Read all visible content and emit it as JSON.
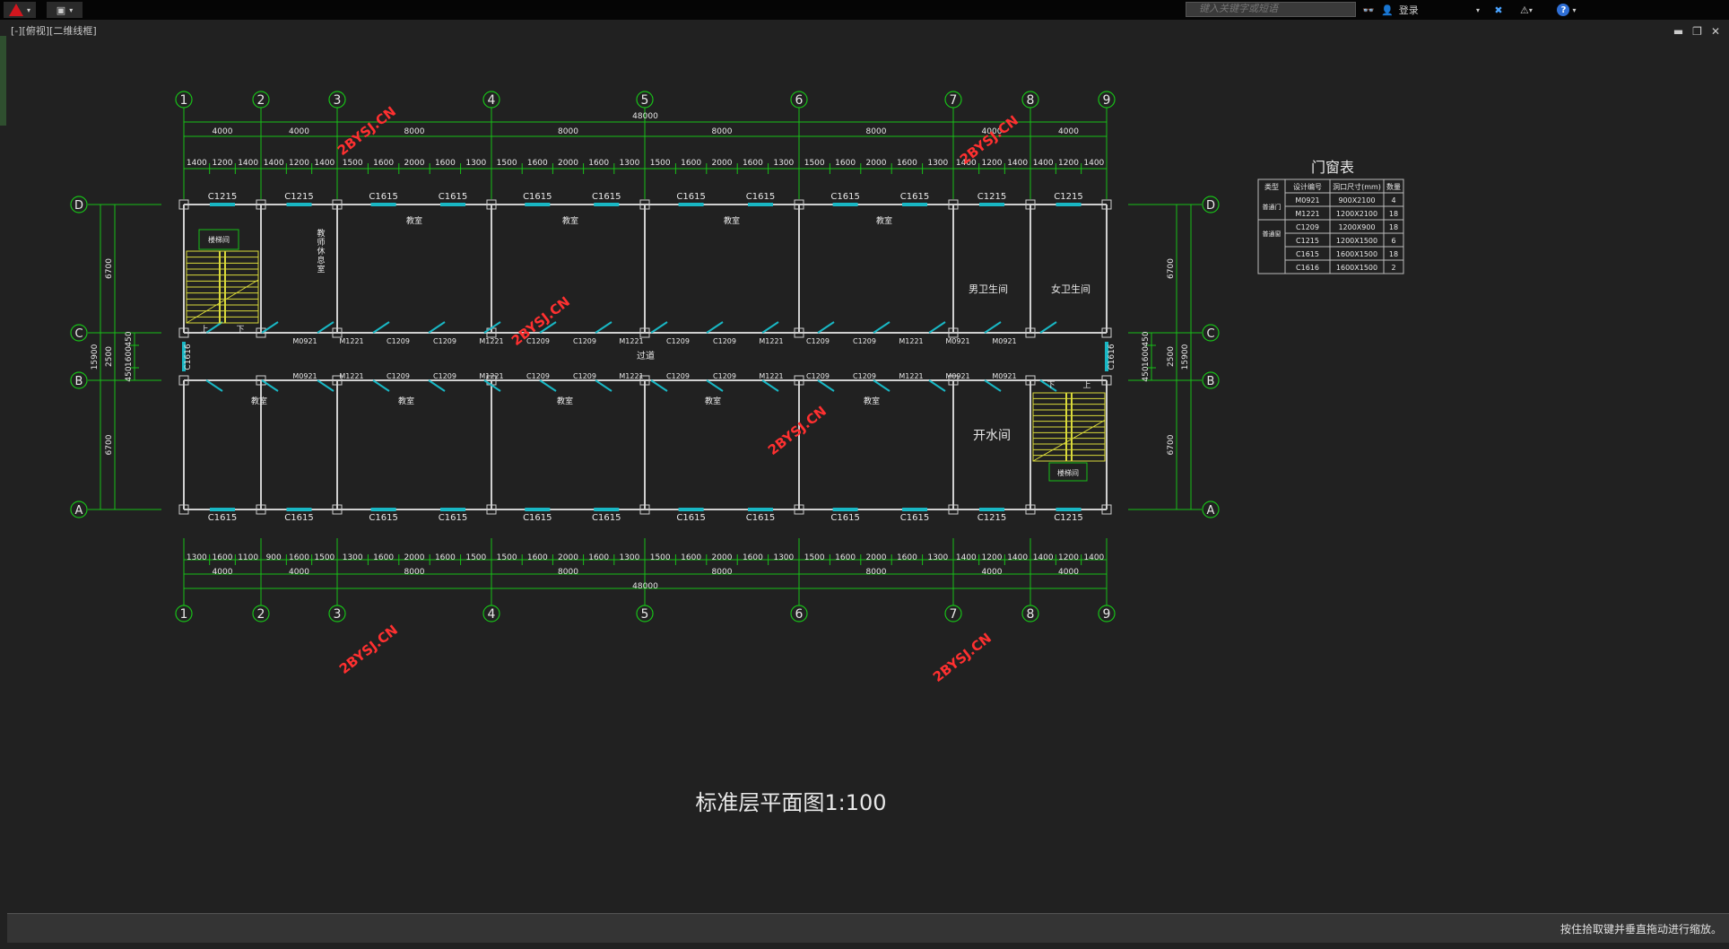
{
  "titlebar": {
    "search_placeholder": "键入关键字或短语",
    "login_label": "登录"
  },
  "viewport": {
    "label": "[-][俯视][二维线框]"
  },
  "drawing": {
    "title": "标准层平面图1:100",
    "overall_dim": "48000",
    "col_labels": [
      "1",
      "2",
      "3",
      "4",
      "5",
      "6",
      "7",
      "8",
      "9"
    ],
    "row_labels": [
      "D",
      "C",
      "B",
      "A"
    ],
    "bay_dims": [
      "4000",
      "4000",
      "8000",
      "8000",
      "8000",
      "8000",
      "4000",
      "4000"
    ],
    "top_detail_dims": [
      "1400",
      "1200",
      "1400",
      "1400",
      "1200",
      "1400",
      "1500",
      "1600",
      "2000",
      "1600",
      "1300",
      "1500",
      "1600",
      "2000",
      "1600",
      "1300",
      "1500",
      "1600",
      "2000",
      "1600",
      "1300",
      "1500",
      "1600",
      "2000",
      "1600",
      "1300",
      "1400",
      "1200",
      "1400",
      "1400",
      "1200",
      "1400"
    ],
    "bottom_detail_dims": [
      "1300",
      "1600",
      "1100",
      "900",
      "1600",
      "1500",
      "1300",
      "1600",
      "2000",
      "1600",
      "1500",
      "1500",
      "1600",
      "2000",
      "1600",
      "1300",
      "1500",
      "1600",
      "2000",
      "1600",
      "1300",
      "1500",
      "1600",
      "2000",
      "1600",
      "1300",
      "1400",
      "1200",
      "1400",
      "1400",
      "1200",
      "1400"
    ],
    "vert_dims_left": [
      "6700",
      "2500",
      "6700",
      "15900"
    ],
    "vert_small_dims": [
      "450",
      "1600",
      "450"
    ],
    "top_windows": [
      "C1215",
      "C1215",
      "C1615",
      "C1615",
      "C1615",
      "C1615",
      "C1615",
      "C1615",
      "C1615",
      "C1615",
      "C1215",
      "C1215"
    ],
    "bottom_windows": [
      "C1615",
      "C1615",
      "C1615",
      "C1615",
      "C1615",
      "C1615",
      "C1615",
      "C1615",
      "C1615",
      "C1615",
      "C1215",
      "C1215"
    ],
    "rooms_top": [
      "教室",
      "教室",
      "教室",
      "教室"
    ],
    "rooms_bottom": [
      "教室",
      "教室",
      "教室",
      "教室",
      "教室"
    ],
    "room_teacher": "教师休息室",
    "room_male_wc": "男卫生间",
    "room_female_wc": "女卫生间",
    "room_boiler": "开水间",
    "stair_label": "楼梯间",
    "corridor": "过道",
    "corridor_doors": [
      "M0921",
      "M1221",
      "C1209",
      "C1209",
      "M1221",
      "C1209",
      "C1209",
      "M1221",
      "C1209",
      "C1209",
      "M1221",
      "C1209",
      "C1209",
      "M1221",
      "M0921",
      "M0921"
    ],
    "side_windows": [
      "C1616",
      "C1616"
    ],
    "watermark": "2BYSJ.CN",
    "up_label": "上",
    "down_label": "下"
  },
  "door_window_table": {
    "title": "门窗表",
    "headers": [
      "类型",
      "设计编号",
      "洞口尺寸(mm)",
      "数量"
    ],
    "rows": [
      {
        "type": "普通门",
        "code": "M0921",
        "size": "900X2100",
        "qty": "4"
      },
      {
        "type": "",
        "code": "M1221",
        "size": "1200X2100",
        "qty": "18"
      },
      {
        "type": "普通窗",
        "code": "C1209",
        "size": "1200X900",
        "qty": "18"
      },
      {
        "type": "",
        "code": "C1215",
        "size": "1200X1500",
        "qty": "6"
      },
      {
        "type": "",
        "code": "C1615",
        "size": "1600X1500",
        "qty": "18"
      },
      {
        "type": "",
        "code": "C1616",
        "size": "1600X1500",
        "qty": "2"
      }
    ]
  },
  "status": {
    "message": "按住拾取键并垂直拖动进行缩放。"
  },
  "colors": {
    "axis": "#18c018",
    "wall": "#d0d0d0",
    "window": "#19b7c4",
    "stair": "#d9d93a",
    "watermark": "#ff3030",
    "text": "#e8e8e8",
    "background": "#212121"
  }
}
